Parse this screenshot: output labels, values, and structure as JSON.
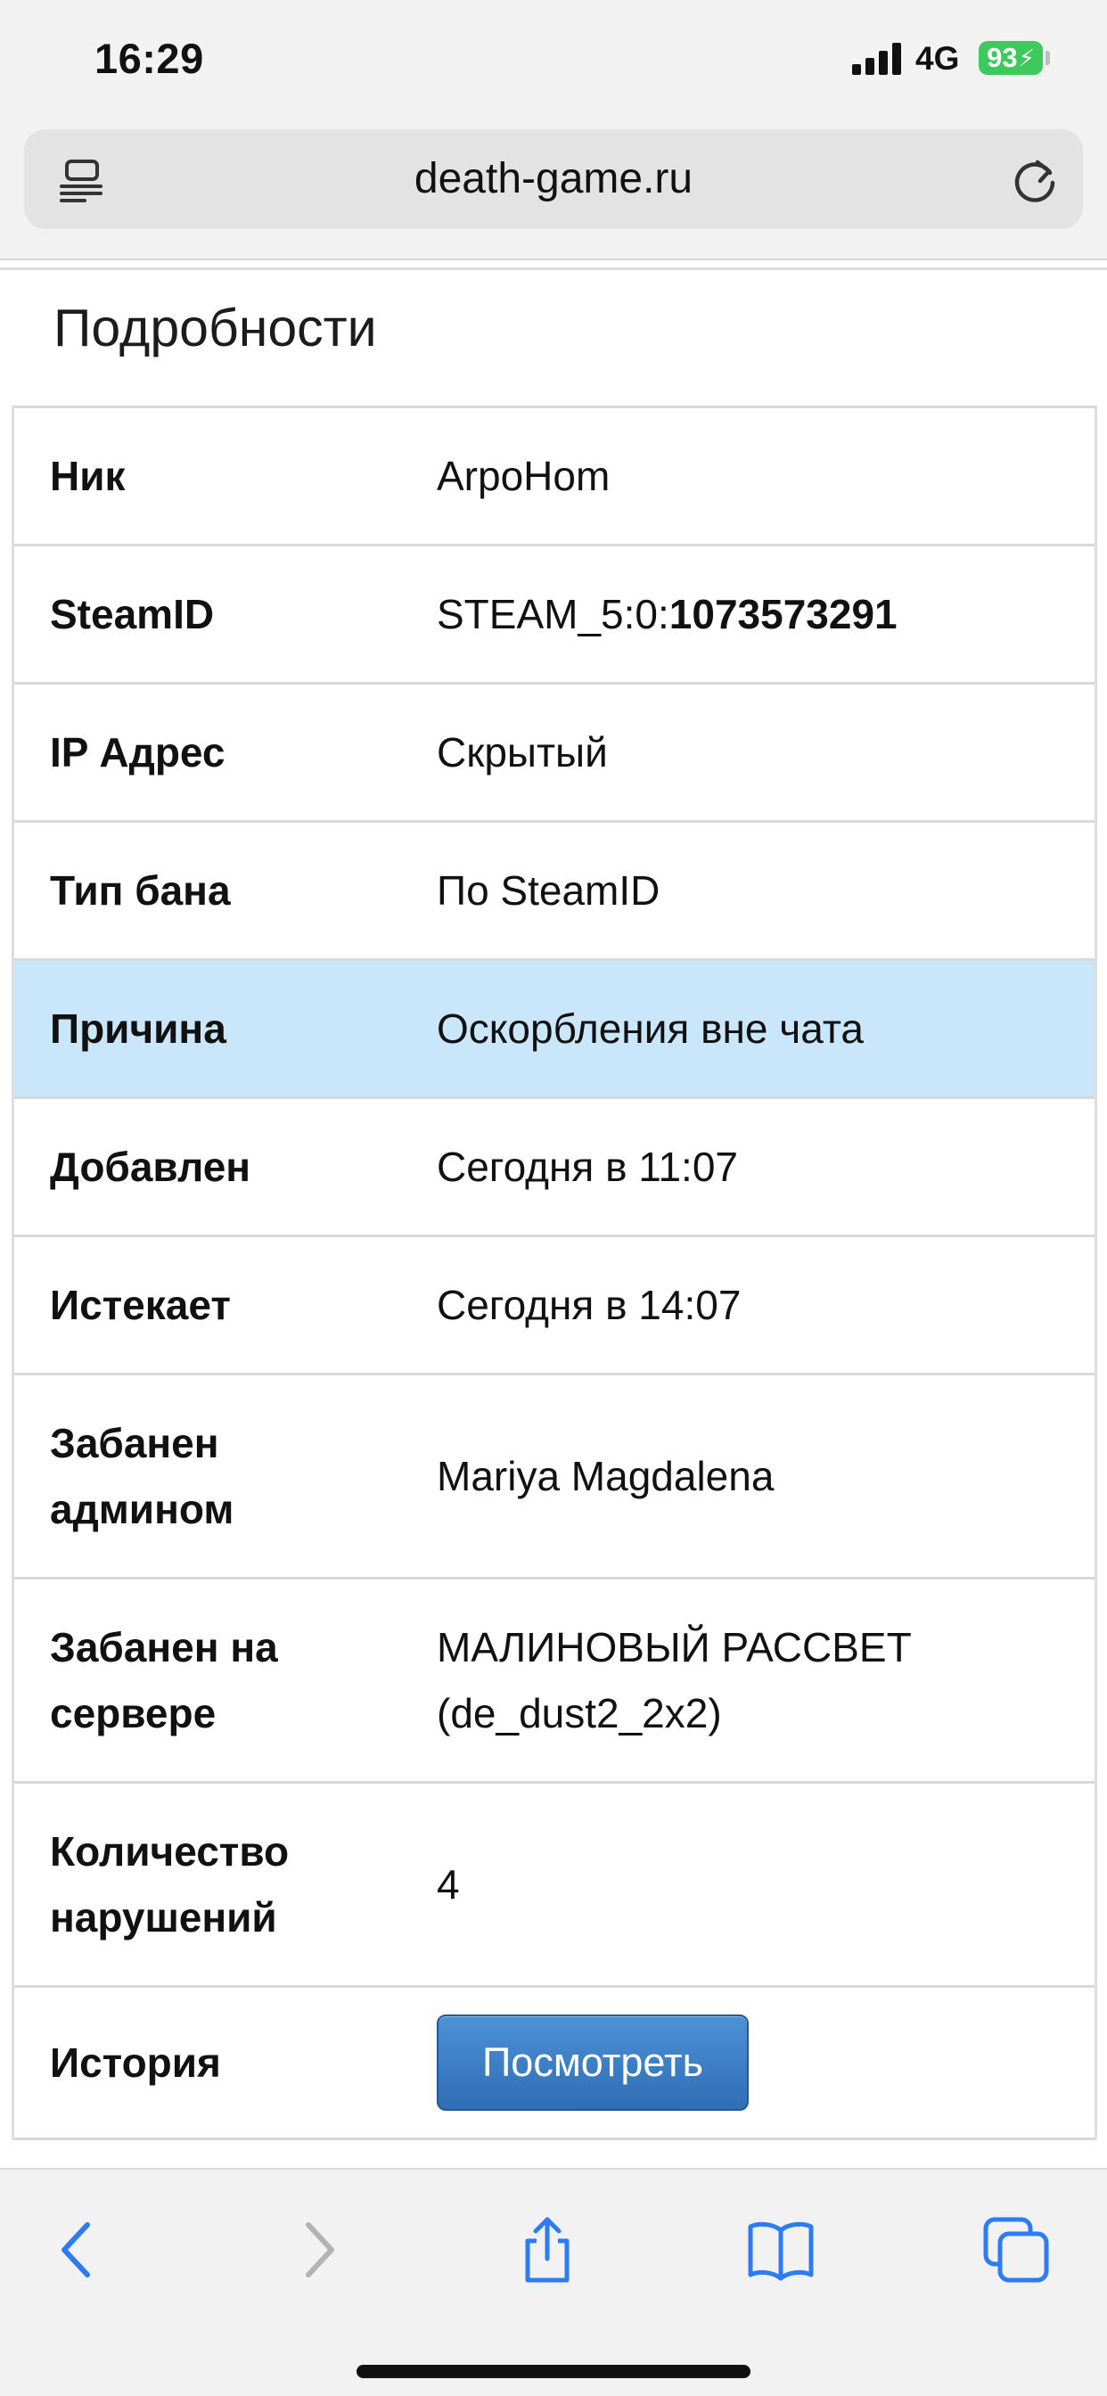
{
  "status_bar": {
    "time": "16:29",
    "network": "4G",
    "battery": "93",
    "battery_color": "#3ec95c",
    "signal_bars": 4
  },
  "browser": {
    "url": "death-game.ru",
    "reader_icon": "reader-icon",
    "reload_icon": "reload-icon"
  },
  "page": {
    "section_title": "Подробности",
    "rows": [
      {
        "label": "Ник",
        "value": "ArpoHom"
      },
      {
        "label": "SteamID",
        "value_prefix": "STEAM_5:0:",
        "value_bold": "1073573291"
      },
      {
        "label": "IP Адрес",
        "value": "Скрытый"
      },
      {
        "label": "Тип бана",
        "value": "По SteamID"
      },
      {
        "label": "Причина",
        "value": "Оскорбления вне чата",
        "highlight_color": "#c9e6fb"
      },
      {
        "label": "Добавлен",
        "value": "Сегодня в 11:07"
      },
      {
        "label": "Истекает",
        "value": "Сегодня в 14:07"
      },
      {
        "label_line1": "Забанен",
        "label_line2": "админом",
        "value": "Mariya Magdalena"
      },
      {
        "label_line1": "Забанен на",
        "label_line2": "сервере",
        "value_line1": "МАЛИНОВЫЙ РАССВЕТ",
        "value_line2": "(de_dust2_2x2)"
      },
      {
        "label_line1": "Количество",
        "label_line2": "нарушений",
        "value": "4"
      },
      {
        "label": "История",
        "button": "Посмотреть"
      }
    ]
  },
  "toolbar": {
    "accent_color": "#2d7cf6",
    "items": [
      "back-icon",
      "forward-icon",
      "share-icon",
      "bookmarks-icon",
      "tabs-icon"
    ]
  }
}
